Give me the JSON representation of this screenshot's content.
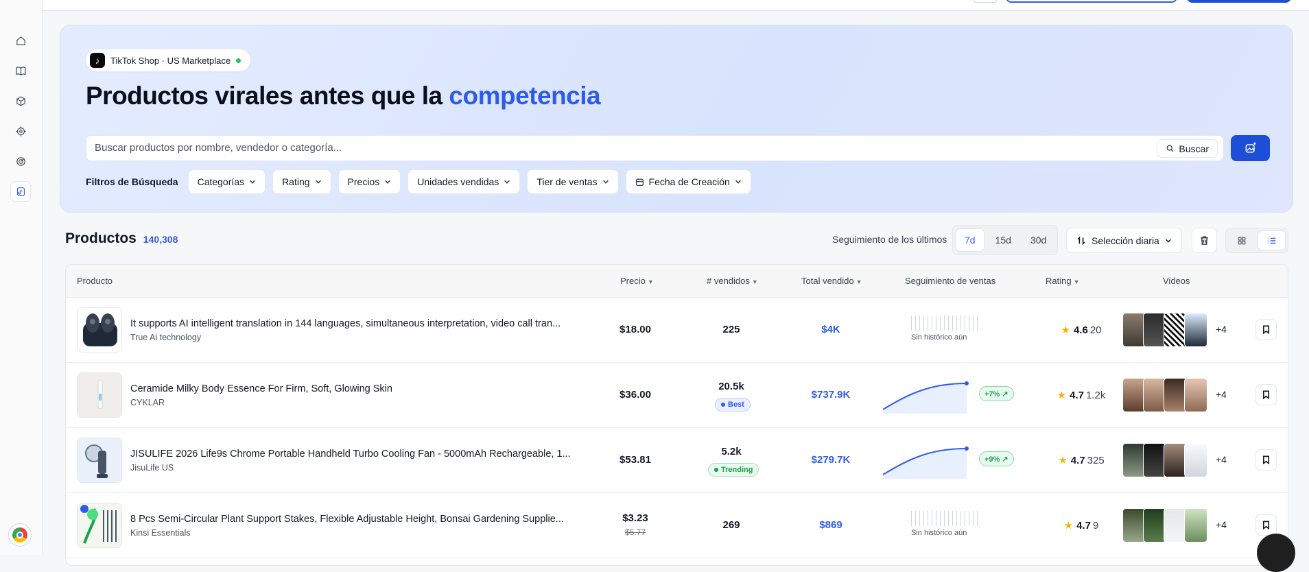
{
  "hero": {
    "pill_label": "TikTok Shop · US Marketplace",
    "title_main": "Productos virales antes que la ",
    "title_accent": "competencia",
    "search_placeholder": "Buscar productos por nombre, vendedor o categoría...",
    "search_button": "Buscar",
    "filters_label": "Filtros de Búsqueda",
    "filters": [
      "Categorías",
      "Rating",
      "Precios",
      "Unidades vendidas",
      "Tier de ventas",
      "Fecha de Creación"
    ]
  },
  "products": {
    "title": "Productos",
    "count": "140,308",
    "tracking_label": "Seguimiento de los últimos",
    "periods": [
      "7d",
      "15d",
      "30d"
    ],
    "active_period": "7d",
    "sort_label": "Selección diaria"
  },
  "table": {
    "headers": {
      "product": "Producto",
      "price": "Precio",
      "sold": "# vendidos",
      "total": "Total vendido",
      "tracking": "Seguimiento de ventas",
      "rating": "Rating",
      "videos": "Videos"
    },
    "rows": [
      {
        "name": "It supports AI intelligent translation in 144 languages, simultaneous interpretation, video call tran...",
        "seller": "True Ai technology",
        "price": "$18.00",
        "old_price": "",
        "sold": "225",
        "badge": "",
        "total": "$4K",
        "tracking_text": "Sin histórico aún",
        "trend_pct": "",
        "rating": "4.6",
        "rating_count": "20",
        "videos_more": "+4"
      },
      {
        "name": "Ceramide Milky Body Essence For Firm, Soft, Glowing Skin",
        "seller": "CYKLAR",
        "price": "$36.00",
        "old_price": "",
        "sold": "20.5k",
        "badge": "Best",
        "total": "$737.9K",
        "tracking_text": "",
        "trend_pct": "+7% ↗",
        "rating": "4.7",
        "rating_count": "1.2k",
        "videos_more": "+4"
      },
      {
        "name": "JISULIFE 2026 Life9s Chrome Portable Handheld Turbo Cooling Fan - 5000mAh Rechargeable, 1...",
        "seller": "JisuLife US",
        "price": "$53.81",
        "old_price": "",
        "sold": "5.2k",
        "badge": "Trending",
        "total": "$279.7K",
        "tracking_text": "",
        "trend_pct": "+9% ↗",
        "rating": "4.7",
        "rating_count": "325",
        "videos_more": "+4"
      },
      {
        "name": "8 Pcs Semi-Circular Plant Support Stakes, Flexible Adjustable Height, Bonsai Gardening Supplie...",
        "seller": "Kinsi Essentials",
        "price": "$3.23",
        "old_price": "$5.77",
        "sold": "269",
        "badge": "",
        "total": "$869",
        "tracking_text": "Sin histórico aún",
        "trend_pct": "",
        "rating": "4.7",
        "rating_count": "9",
        "videos_more": "+4"
      }
    ]
  },
  "colors": {
    "accent": "#2f5bea",
    "primary_button": "#1d4ed8",
    "positive": "#16a34a",
    "star": "#f5b400"
  }
}
